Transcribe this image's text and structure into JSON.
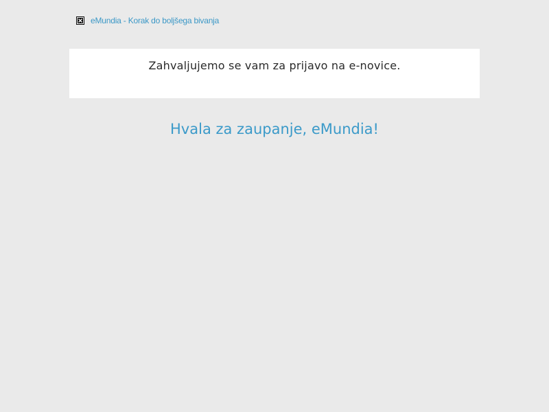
{
  "header": {
    "logo_image_icon": "broken-image-icon",
    "logo_link_text": "eMundia - Korak do boljšega bivanja"
  },
  "message": {
    "text": "Zahvaljujemo se vam za prijavo na e-novice."
  },
  "thanks": {
    "text": "Hvala za zaupanje, eMundia!"
  },
  "colors": {
    "background": "#eaeaea",
    "panel": "#ffffff",
    "accent": "#3b9ac9",
    "body_text": "#2a2a2a"
  }
}
